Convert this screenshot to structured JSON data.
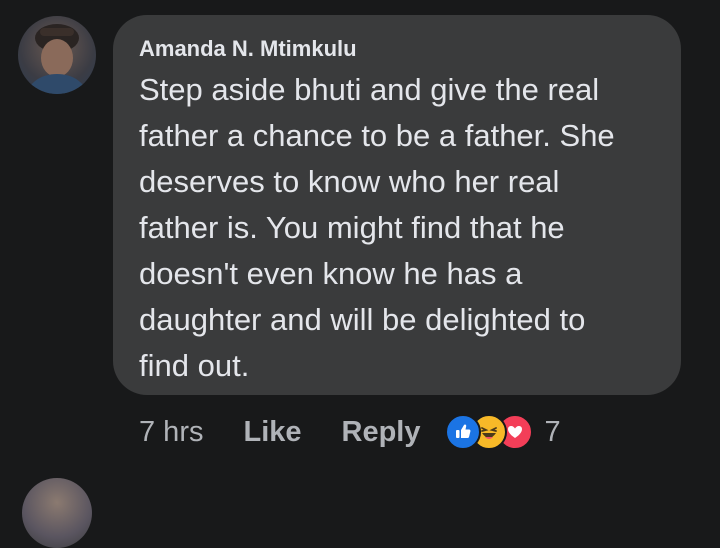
{
  "comment": {
    "author": "Amanda N. Mtimkulu",
    "text": "Step aside bhuti and give the real\nfather a chance to be a father. She\ndeserves to know who her real\nfather is. You might find that he\ndoesn't even know he has a\ndaughter and will be delighted to\nfind out.",
    "time": "7 hrs",
    "like_label": "Like",
    "reply_label": "Reply",
    "reactions": [
      "like-icon",
      "haha-icon",
      "love-icon"
    ],
    "reaction_count": "7"
  },
  "colors": {
    "background": "#18191a",
    "bubble": "#3a3b3c",
    "text": "#e4e6eb",
    "secondary_text": "#b0b3b8",
    "like_blue": "#1b74e4",
    "haha_yellow": "#f7b928",
    "love_red": "#f33e58"
  }
}
